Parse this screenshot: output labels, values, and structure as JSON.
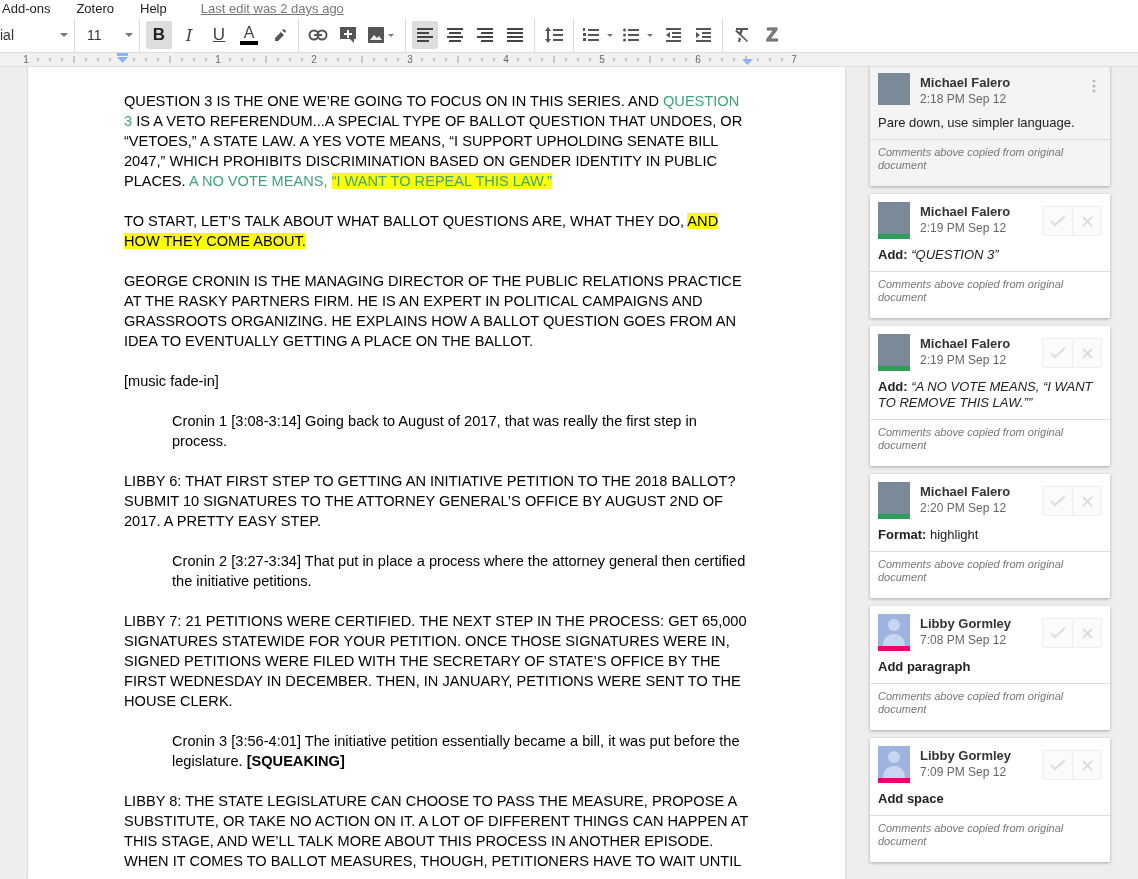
{
  "menu": {
    "items": [
      "Add-ons",
      "Zotero",
      "Help"
    ],
    "last_edit": "Last edit was 2 days ago"
  },
  "toolbar": {
    "groups": [
      [
        {
          "kind": "font",
          "value": "ial"
        }
      ],
      [
        {
          "kind": "size",
          "value": "11"
        }
      ],
      [
        {
          "kind": "bold",
          "label": "B",
          "selected": true
        },
        {
          "kind": "italic",
          "label": "I",
          "selected": false
        },
        {
          "kind": "underline",
          "label": "U",
          "selected": false
        },
        {
          "kind": "text_color",
          "label": "A",
          "selected": false
        },
        {
          "kind": "highlight",
          "selected": false
        }
      ],
      [
        {
          "kind": "link",
          "selected": false
        },
        {
          "kind": "comment",
          "selected": false
        },
        {
          "kind": "image",
          "selected": false
        }
      ],
      [
        {
          "kind": "align_left",
          "selected": true
        },
        {
          "kind": "align_center",
          "selected": false
        },
        {
          "kind": "align_right",
          "selected": false
        },
        {
          "kind": "justify",
          "selected": false
        }
      ],
      [
        {
          "kind": "line_spacing",
          "selected": false
        }
      ],
      [
        {
          "kind": "numbered_list",
          "selected": false
        },
        {
          "kind": "bulleted_list",
          "selected": false
        },
        {
          "kind": "indent_less",
          "selected": false
        },
        {
          "kind": "indent_more",
          "selected": false
        }
      ],
      [
        {
          "kind": "clear_format",
          "selected": false
        },
        {
          "kind": "zotero",
          "label": "Z",
          "selected": false
        }
      ]
    ]
  },
  "ruler": {
    "labels": [
      "1",
      "1",
      "2",
      "3",
      "4",
      "5",
      "6",
      "7"
    ]
  },
  "document": {
    "paragraphs": [
      {
        "kind": "body",
        "segments": [
          {
            "text": "QUESTION 3 IS THE ONE WE’RE GOING TO FOCUS ON IN THIS SERIES. AND ",
            "suggested": false,
            "highlighted": false
          },
          {
            "text": "QUESTION 3",
            "suggested": true,
            "highlighted": false
          },
          {
            "text": " IS A VETO REFERENDUM...A SPECIAL TYPE OF BALLOT QUESTION THAT UNDOES, OR “VETOES,” A STATE LAW. A YES VOTE MEANS, “I SUPPORT UPHOLDING SENATE BILL 2047,” WHICH PROHIBITS DISCRIMINATION BASED ON GENDER IDENTITY IN PUBLIC PLACES. ",
            "suggested": false,
            "highlighted": false
          },
          {
            "text": "A NO VOTE MEANS, ",
            "suggested": true,
            "highlighted": false
          },
          {
            "text": "“I WANT TO REPEAL THIS LAW.”",
            "suggested": true,
            "highlighted": true
          }
        ]
      },
      {
        "kind": "body",
        "segments": [
          {
            "text": "TO START, LET’S TALK ABOUT WHAT BALLOT QUESTIONS ARE, WHAT THEY DO, ",
            "suggested": false,
            "highlighted": false
          },
          {
            "text": "AND HOW THEY COME ABOUT.",
            "suggested": false,
            "highlighted": true
          }
        ]
      },
      {
        "kind": "body",
        "segments": [
          {
            "text": "GEORGE CRONIN IS THE MANAGING DIRECTOR OF THE PUBLIC RELATIONS PRACTICE AT THE RASKY PARTNERS FIRM. HE IS AN EXPERT IN POLITICAL CAMPAIGNS AND GRASSROOTS ORGANIZING. HE EXPLAINS HOW A BALLOT QUESTION GOES FROM AN IDEA TO EVENTUALLY GETTING A PLACE ON THE BALLOT.",
            "suggested": false,
            "highlighted": false
          }
        ]
      },
      {
        "kind": "body",
        "segments": [
          {
            "text": "[music fade-in]",
            "suggested": false,
            "highlighted": false
          }
        ]
      },
      {
        "kind": "quote",
        "segments": [
          {
            "text": "Cronin 1 [3:08-3:14] Going back to August of 2017, that was really the first step in process.",
            "suggested": false,
            "highlighted": false
          }
        ]
      },
      {
        "kind": "body",
        "segments": [
          {
            "text": "LIBBY 6: THAT FIRST STEP TO GETTING AN INITIATIVE PETITION TO THE 2018 BALLOT? SUBMIT 10 SIGNATURES TO THE ATTORNEY GENERAL’S OFFICE BY AUGUST 2ND OF 2017. A PRETTY EASY STEP.",
            "suggested": false,
            "highlighted": false
          }
        ]
      },
      {
        "kind": "quote",
        "segments": [
          {
            "text": "Cronin 2 [3:27-3:34] That put in place a process where the attorney general then certified the initiative petitions.",
            "suggested": false,
            "highlighted": false
          }
        ]
      },
      {
        "kind": "body",
        "segments": [
          {
            "text": "LIBBY 7: 21 PETITIONS WERE CERTIFIED. THE NEXT STEP  IN THE PROCESS: GET 65,000 SIGNATURES STATEWIDE FOR YOUR PETITION. ONCE THOSE SIGNATURES WERE IN, SIGNED PETITIONS WERE FILED WITH THE SECRETARY OF STATE’S OFFICE BY THE FIRST WEDNESDAY IN DECEMBER. THEN, IN JANUARY, PETITIONS WERE SENT TO THE HOUSE CLERK.",
            "suggested": false,
            "highlighted": false
          }
        ]
      },
      {
        "kind": "quote",
        "segments": [
          {
            "text": "Cronin 3 [3:56-4:01] The initiative petition essentially became a bill, it was put before the legislature. **[SQUEAKING]**",
            "suggested": false,
            "highlighted": false
          }
        ]
      },
      {
        "kind": "body",
        "segments": [
          {
            "text": "LIBBY 8: THE STATE LEGISLATURE CAN CHOOSE TO PASS THE MEASURE, PROPOSE A SUBSTITUTE, OR TAKE NO ACTION ON IT. A LOT OF DIFFERENT THINGS CAN HAPPEN AT THIS STAGE, AND WE’LL TALK MORE ABOUT THIS PROCESS IN ANOTHER EPISODE. WHEN IT COMES TO BALLOT MEASURES, THOUGH, PETITIONERS HAVE TO WAIT UNTIL",
            "suggested": false,
            "highlighted": false
          }
        ]
      }
    ]
  },
  "comments": [
    {
      "kind": "photo",
      "author": "Michael Falero",
      "time": "2:18 PM Sep 12",
      "selected": true,
      "body": "Pare down, use simpler language.",
      "body_bold": false,
      "footer": "Comments above copied from original document"
    },
    {
      "kind": "photo",
      "author": "Michael Falero",
      "time": "2:19 PM Sep 12",
      "color": "#2e9e5b",
      "selected": false,
      "body": "**Add:** *“QUESTION 3”*",
      "body_bold": false,
      "footer": "Comments above copied from original document"
    },
    {
      "kind": "photo",
      "author": "Michael Falero",
      "time": "2:19 PM Sep 12",
      "color": "#2e9e5b",
      "selected": false,
      "body": "**Add:** *“A NO VOTE MEANS, “I WANT TO REMOVE THIS LAW.””*",
      "body_bold": false,
      "footer": "Comments above copied from original document"
    },
    {
      "kind": "photo",
      "author": "Michael Falero",
      "time": "2:20 PM Sep 12",
      "color": "#2e9e5b",
      "selected": false,
      "body": "**Format:** highlight",
      "body_bold": false,
      "footer": "Comments above copied from original document"
    },
    {
      "kind": "silhouette",
      "author": "Libby Gormley",
      "time": "7:08 PM Sep 12",
      "color": "#f0006a",
      "selected": false,
      "body": "Add paragraph",
      "body_bold": true,
      "footer": "Comments above copied from original document"
    },
    {
      "kind": "silhouette",
      "author": "Libby Gormley",
      "time": "7:09 PM Sep 12",
      "color": "#f0006a",
      "selected": false,
      "body": "Add space",
      "body_bold": true,
      "footer": "Comments above copied from original document"
    }
  ]
}
